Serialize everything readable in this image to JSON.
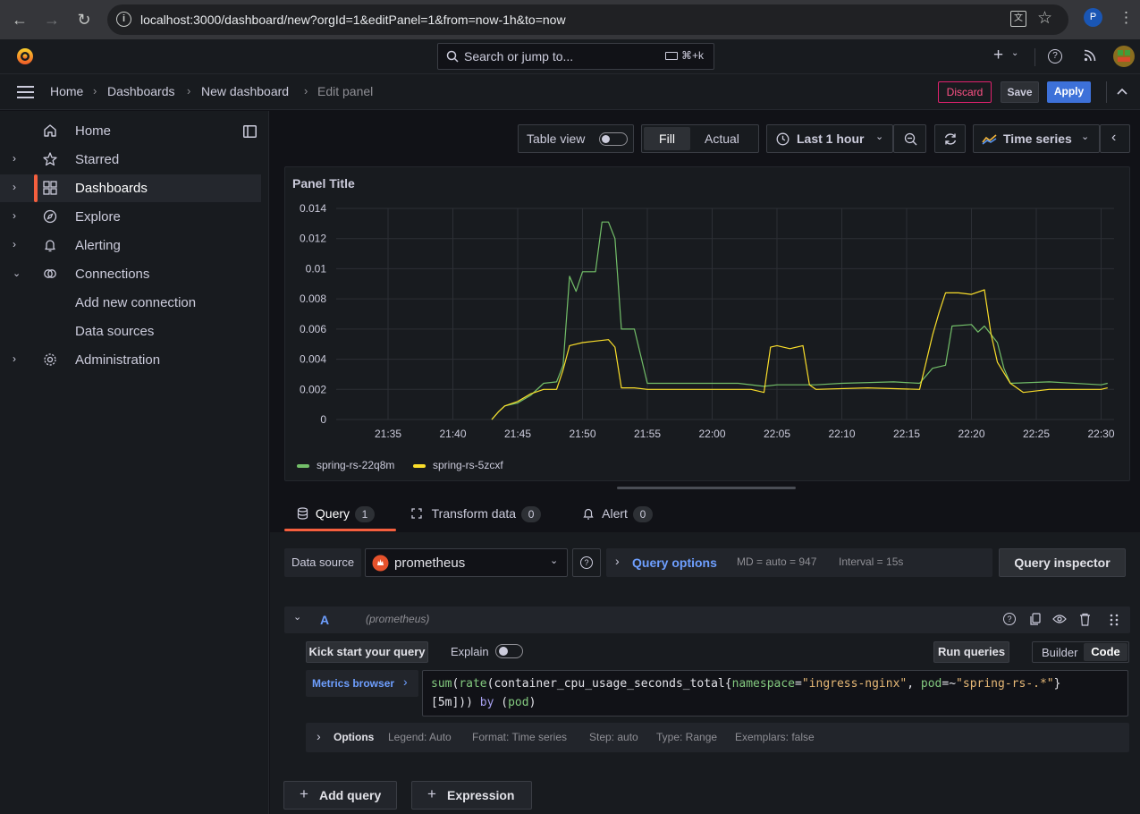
{
  "browser": {
    "url": "localhost:3000/dashboard/new?orgId=1&editPanel=1&from=now-1h&to=now",
    "profile_initial": "P"
  },
  "topbar": {
    "search_placeholder": "Search or jump to...",
    "shortcut": "⌘+k"
  },
  "breadcrumbs": [
    "Home",
    "Dashboards",
    "New dashboard",
    "Edit panel"
  ],
  "header_actions": {
    "discard": "Discard",
    "save": "Save",
    "apply": "Apply"
  },
  "sidebar": {
    "items": [
      {
        "label": "Home",
        "icon": "home-icon",
        "expandable": false
      },
      {
        "label": "Starred",
        "icon": "star-icon",
        "expandable": true
      },
      {
        "label": "Dashboards",
        "icon": "apps-icon",
        "expandable": true,
        "active": true
      },
      {
        "label": "Explore",
        "icon": "compass-icon",
        "expandable": true
      },
      {
        "label": "Alerting",
        "icon": "bell-icon",
        "expandable": true
      },
      {
        "label": "Connections",
        "icon": "connections-icon",
        "expandable": true,
        "expanded": true
      },
      {
        "label": "Add new connection",
        "sub": true
      },
      {
        "label": "Data sources",
        "sub": true
      },
      {
        "label": "Administration",
        "icon": "cog-icon",
        "expandable": true
      }
    ]
  },
  "toolbar": {
    "table_view": "Table view",
    "fill": "Fill",
    "actual": "Actual",
    "time_range": "Last 1 hour",
    "visualization": "Time series"
  },
  "panel": {
    "title": "Panel Title"
  },
  "chart_data": {
    "type": "line",
    "title": "Panel Title",
    "x_ticks": [
      "21:35",
      "21:40",
      "21:45",
      "21:50",
      "21:55",
      "22:00",
      "22:05",
      "22:10",
      "22:15",
      "22:20",
      "22:25",
      "22:30"
    ],
    "y_ticks": [
      "0",
      "0.002",
      "0.004",
      "0.006",
      "0.008",
      "0.01",
      "0.012",
      "0.014"
    ],
    "ylim": [
      0,
      0.014
    ],
    "xlim_minutes": [
      "21:31",
      "22:31"
    ],
    "grid": true,
    "legend": "bottom-left",
    "series": [
      {
        "name": "spring-rs-22q8m",
        "color": "#73bf69",
        "points": [
          [
            "21:43",
            0
          ],
          [
            "21:43.5",
            0.0005
          ],
          [
            "21:44",
            0.0009
          ],
          [
            "21:45",
            0.0011
          ],
          [
            "21:46",
            0.0016
          ],
          [
            "21:47",
            0.0024
          ],
          [
            "21:48",
            0.0025
          ],
          [
            "21:48.5",
            0.0036
          ],
          [
            "21:49",
            0.0095
          ],
          [
            "21:49.5",
            0.0085
          ],
          [
            "21:50",
            0.0098
          ],
          [
            "21:51",
            0.0098
          ],
          [
            "21:51.5",
            0.0131
          ],
          [
            "21:52",
            0.0131
          ],
          [
            "21:52.5",
            0.012
          ],
          [
            "21:53",
            0.006
          ],
          [
            "21:54",
            0.006
          ],
          [
            "21:55",
            0.0024
          ],
          [
            "21:58",
            0.0024
          ],
          [
            "22:02",
            0.0024
          ],
          [
            "22:04",
            0.0022
          ],
          [
            "22:05",
            0.0023
          ],
          [
            "22:08",
            0.0023
          ],
          [
            "22:10",
            0.0024
          ],
          [
            "22:14",
            0.0025
          ],
          [
            "22:16",
            0.0024
          ],
          [
            "22:17",
            0.0034
          ],
          [
            "22:18",
            0.0036
          ],
          [
            "22:18.5",
            0.0062
          ],
          [
            "22:20",
            0.0063
          ],
          [
            "22:20.5",
            0.0058
          ],
          [
            "22:21",
            0.0062
          ],
          [
            "22:22",
            0.0051
          ],
          [
            "22:22.5",
            0.0034
          ],
          [
            "22:23",
            0.0024
          ],
          [
            "22:26",
            0.0025
          ],
          [
            "22:30",
            0.0023
          ],
          [
            "22:30.5",
            0.0024
          ]
        ]
      },
      {
        "name": "spring-rs-5zcxf",
        "color": "#fade2a",
        "points": [
          [
            "21:43",
            0
          ],
          [
            "21:43.5",
            0.0005
          ],
          [
            "21:44",
            0.0009
          ],
          [
            "21:45",
            0.0012
          ],
          [
            "21:46",
            0.0017
          ],
          [
            "21:47",
            0.002
          ],
          [
            "21:48",
            0.002
          ],
          [
            "21:48.5",
            0.0033
          ],
          [
            "21:49",
            0.0049
          ],
          [
            "21:50",
            0.0051
          ],
          [
            "21:51",
            0.0052
          ],
          [
            "21:52",
            0.0053
          ],
          [
            "21:52.5",
            0.0048
          ],
          [
            "21:53",
            0.0021
          ],
          [
            "21:54",
            0.0021
          ],
          [
            "21:55",
            0.002
          ],
          [
            "21:58",
            0.002
          ],
          [
            "22:02",
            0.002
          ],
          [
            "22:03",
            0.002
          ],
          [
            "22:04",
            0.0018
          ],
          [
            "22:04.5",
            0.0048
          ],
          [
            "22:05",
            0.0049
          ],
          [
            "22:06",
            0.0047
          ],
          [
            "22:07",
            0.0049
          ],
          [
            "22:07.5",
            0.0023
          ],
          [
            "22:08",
            0.002
          ],
          [
            "22:12",
            0.0021
          ],
          [
            "22:16",
            0.002
          ],
          [
            "22:17",
            0.0056
          ],
          [
            "22:17.5",
            0.0071
          ],
          [
            "22:18",
            0.0084
          ],
          [
            "22:19",
            0.0084
          ],
          [
            "22:20",
            0.0083
          ],
          [
            "22:21",
            0.0086
          ],
          [
            "22:21.5",
            0.0057
          ],
          [
            "22:22",
            0.0038
          ],
          [
            "22:23",
            0.0024
          ],
          [
            "22:24",
            0.0018
          ],
          [
            "22:26",
            0.002
          ],
          [
            "22:30",
            0.002
          ],
          [
            "22:30.5",
            0.0021
          ]
        ]
      }
    ]
  },
  "query_tabs": [
    {
      "label": "Query",
      "count": "1",
      "icon": "database-icon"
    },
    {
      "label": "Transform data",
      "count": "0",
      "icon": "process-icon"
    },
    {
      "label": "Alert",
      "count": "0",
      "icon": "bell-icon"
    }
  ],
  "datasource": {
    "label": "Data source",
    "value": "prometheus",
    "query_options": "Query options",
    "md": "MD = auto = 947",
    "interval": "Interval = 15s",
    "inspector": "Query inspector"
  },
  "query": {
    "ref": "A",
    "datasource": "(prometheus)",
    "kick_start": "Kick start your query",
    "explain": "Explain",
    "run": "Run queries",
    "builder": "Builder",
    "code": "Code",
    "metrics_browser": "Metrics browser",
    "expr_line1": "sum(rate(container_cpu_usage_seconds_total{namespace=\"ingress-nginx\", pod=~\"spring-rs-.*\"}",
    "expr_line2": "[5m])) by (pod)",
    "options_title": "Options",
    "options": [
      "Legend: Auto",
      "Format: Time series",
      "Step: auto",
      "Type: Range",
      "Exemplars: false"
    ]
  },
  "footer": {
    "add_query": "Add query",
    "expression": "Expression"
  }
}
